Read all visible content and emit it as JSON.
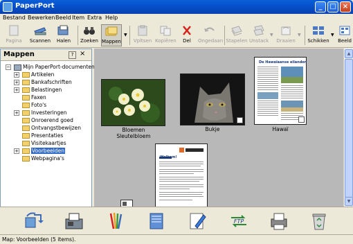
{
  "window": {
    "title": "PaperPort"
  },
  "menu": [
    "Bestand",
    "Bewerken",
    "Beeld",
    "Item",
    "Extra",
    "Help"
  ],
  "toolbar": {
    "items": [
      {
        "label": "Pagina",
        "icon": "page-icon",
        "enabled": false
      },
      {
        "label": "Scannen",
        "icon": "scanner-icon",
        "enabled": true
      },
      {
        "label": "Halen",
        "icon": "import-icon",
        "enabled": true
      },
      {
        "label": "Zoeken",
        "icon": "binoculars-icon",
        "enabled": true
      },
      {
        "label": "Mappen",
        "icon": "folders-icon",
        "enabled": true,
        "active": true
      },
      {
        "label": "Vpltsen",
        "icon": "paste-icon",
        "enabled": false
      },
      {
        "label": "Kopiëren",
        "icon": "copy-icon",
        "enabled": false
      },
      {
        "label": "Del",
        "icon": "delete-icon",
        "enabled": true
      },
      {
        "label": "Ongedaan",
        "icon": "undo-icon",
        "enabled": false
      },
      {
        "label": "Stapelen",
        "icon": "stack-icon",
        "enabled": false
      },
      {
        "label": "Unstack",
        "icon": "unstack-icon",
        "enabled": false
      },
      {
        "label": "Draaien",
        "icon": "rotate-icon",
        "enabled": false
      },
      {
        "label": "Schikken",
        "icon": "arrange-icon",
        "enabled": true
      },
      {
        "label": "Beeld",
        "icon": "view-icon",
        "enabled": true
      }
    ]
  },
  "folders_pane": {
    "title": "Mappen",
    "help": "?",
    "close": "×",
    "root": "Mijn PaperPort-documenten",
    "items": [
      {
        "label": "Artikelen",
        "expandable": true
      },
      {
        "label": "Bankafschriften",
        "expandable": true
      },
      {
        "label": "Belastingen",
        "expandable": true
      },
      {
        "label": "Faxen",
        "expandable": false
      },
      {
        "label": "Foto's",
        "expandable": false
      },
      {
        "label": "Investeringen",
        "expandable": true
      },
      {
        "label": "Onroerend goed",
        "expandable": false
      },
      {
        "label": "Ontvangstbewijzen",
        "expandable": false
      },
      {
        "label": "Presentaties",
        "expandable": false
      },
      {
        "label": "Visitekaartjes",
        "expandable": false
      },
      {
        "label": "Voorbeelden",
        "expandable": true,
        "selected": true
      },
      {
        "label": "Webpagina's",
        "expandable": false
      }
    ]
  },
  "documents": [
    {
      "caption_line1": "Bloemen",
      "caption_line2": "Sleutelbloem",
      "kind": "photo-flowers"
    },
    {
      "caption_line1": "Bukje",
      "caption_line2": "",
      "kind": "photo-cat"
    },
    {
      "caption_line1": "Hawaï",
      "caption_line2": "",
      "kind": "document-hawaii",
      "heading": "De Hawaïaanse eilanden"
    },
    {
      "caption_line1": "",
      "caption_line2": "",
      "kind": "document-paperport",
      "heading": "Welkom!"
    }
  ],
  "bottom_bar": [
    "send-to-scan-icon",
    "send-to-fax-icon",
    "send-to-paint-icon",
    "send-to-notes-icon",
    "send-to-editor-icon",
    "send-to-ftp-icon",
    "send-to-printer-icon",
    "send-to-recycle-icon"
  ],
  "status": {
    "text": "Map: Voorbeelden (5 items)."
  },
  "colors": {
    "title_bar": "#0552cc",
    "selection": "#316ac5",
    "workspace": "#b8b8b8"
  }
}
